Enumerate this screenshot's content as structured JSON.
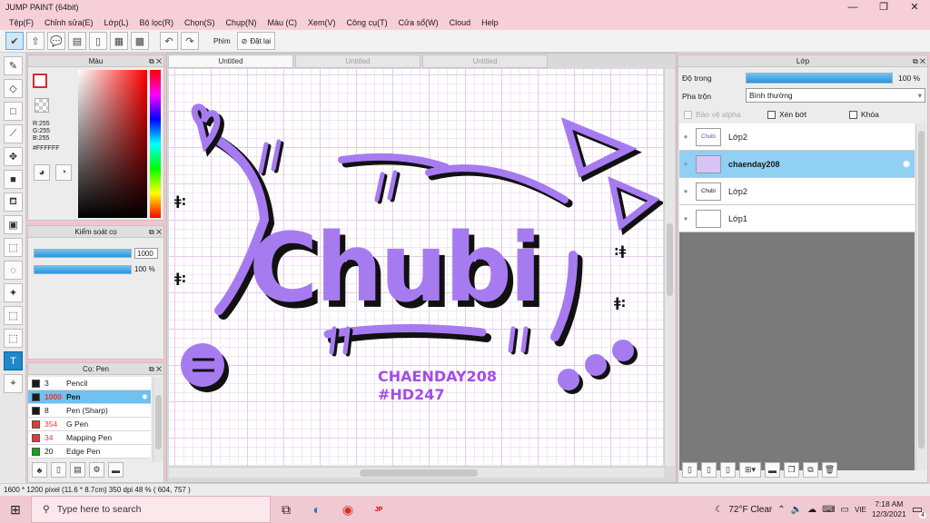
{
  "window": {
    "title": "JUMP PAINT (64bit)",
    "minimize": "—",
    "maximize": "❐",
    "close": "✕"
  },
  "menu": [
    "Tệp(F)",
    "Chỉnh sửa(E)",
    "Lớp(L)",
    "Bộ lọc(R)",
    "Chọn(S)",
    "Chụp(N)",
    "Màu (C)",
    "Xem(V)",
    "Công cụ(T)",
    "Cửa sổ(W)",
    "Cloud",
    "Help"
  ],
  "toolbar": {
    "key_label": "Phím",
    "reset_label": "Đặt lại"
  },
  "color_panel": {
    "title": "Màu",
    "r": "R:255",
    "g": "G:255",
    "b": "B:255",
    "hex": "#FFFFFF"
  },
  "brush_control": {
    "title": "Kiểm soát cọ",
    "size_value": "1000",
    "size_fill": 0.95,
    "opacity_value": "100 %",
    "opacity_fill": 1.0
  },
  "brush_panel": {
    "title": "Cọ: Pen",
    "items": [
      {
        "size": "3",
        "name": "Pencil",
        "color": "#1a1a1a",
        "selected": false
      },
      {
        "size": "1000",
        "name": "Pen",
        "color": "#1a1a1a",
        "selected": true
      },
      {
        "size": "8",
        "name": "Pen (Sharp)",
        "color": "#1a1a1a",
        "selected": false
      },
      {
        "size": "354",
        "name": "G Pen",
        "color": "#e53935",
        "selected": false
      },
      {
        "size": "34",
        "name": "Mapping Pen",
        "color": "#e53935",
        "selected": false
      },
      {
        "size": "20",
        "name": "Edge Pen",
        "color": "#16a316",
        "selected": false
      }
    ]
  },
  "document_tabs": [
    "Untitled",
    "Untitled",
    "Untitled"
  ],
  "canvas_art": {
    "main_text": "Chubi",
    "credit_line1": "CHAENDAY208",
    "credit_line2": "#HD247",
    "accent_color": "#a77bf0"
  },
  "layer_panel": {
    "title": "Lớp",
    "opacity_label": "Độ trong",
    "opacity_value": "100 %",
    "opacity_fill": 1.0,
    "blend_label": "Pha trộn",
    "blend_value": "Bình thường",
    "protect_alpha": "Bảo vệ alpha",
    "clipping": "Xén bớt",
    "lock": "Khóa",
    "layers": [
      {
        "name": "Lớp2",
        "thumb": "Chubi",
        "selected": false
      },
      {
        "name": "chaenday208",
        "thumb": "",
        "selected": true
      },
      {
        "name": "Lớp2",
        "thumb": "Chubi",
        "selected": false
      },
      {
        "name": "Lớp1",
        "thumb": "",
        "selected": false
      }
    ]
  },
  "status_bar": {
    "text": "1600 * 1200 pixel   (11.6 * 8.7cm)   350 dpi   48 %   ( 604, 757 )"
  },
  "taskbar": {
    "search_placeholder": "Type here to search",
    "weather": "72°F  Clear",
    "language": "VIE",
    "time": "7:18 AM",
    "date": "12/3/2021",
    "notification_count": "4"
  }
}
